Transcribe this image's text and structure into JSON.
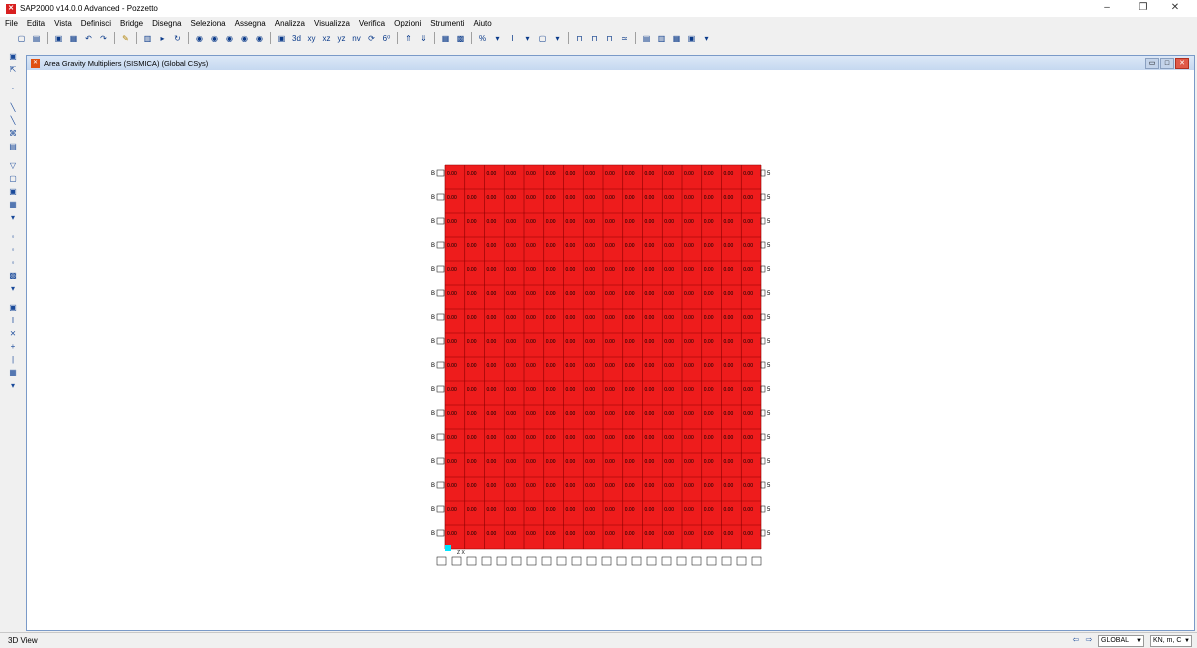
{
  "window": {
    "title": "SAP2000 v14.0.0 Advanced  - Pozzetto",
    "minimize": "–",
    "maximize": "❐",
    "close": "✕"
  },
  "menu": [
    "File",
    "Edita",
    "Vista",
    "Definisci",
    "Bridge",
    "Disegna",
    "Seleziona",
    "Assegna",
    "Analizza",
    "Visualizza",
    "Verifica",
    "Opzioni",
    "Strumenti",
    "Aiuto"
  ],
  "toolbar": {
    "icons": [
      "new-model-icon",
      "open-icon",
      "save-icon",
      "unknown-icon",
      "undo-icon",
      "redo-icon",
      "refresh-window-icon",
      "lock-icon",
      "run-analysis-icon",
      "rubber-band-zoom-icon",
      "restore-view-icon",
      "zoom-in-icon",
      "zoom-out-icon",
      "pan-icon",
      "set-3d-view-icon",
      "xy-view-icon",
      "xz-view-icon",
      "yz-view-icon",
      "nv-view-icon",
      "rotate-3d-icon",
      "perspective-icon",
      "up-icon",
      "down-icon",
      "object-shrink-icon",
      "set-display-icon",
      "show-undeformed-icon",
      "show-deformed-icon",
      "show-forces-icon",
      "show-stress-icon",
      "table-icon",
      "more-icon"
    ],
    "text_buttons": [
      "3d",
      "xy",
      "xz",
      "yz",
      "nv",
      "6⁰"
    ]
  },
  "left_toolbar": {
    "icons": [
      "pointer-icon",
      "reshape-icon",
      "draw-point-icon",
      "draw-frame-icon",
      "draw-cable-icon",
      "draw-link-icon",
      "quick-frame-icon",
      "draw-poly-area-icon",
      "draw-rect-area-icon",
      "quick-area-icon",
      "draw-solid-icon",
      "select-all-icon",
      "get-previous-icon",
      "clear-selection-icon",
      "intersect-line-icon",
      "snap-points-icon",
      "snap-ends-icon",
      "snap-intersections-icon",
      "snap-perpendicular-icon",
      "snap-lines-icon"
    ]
  },
  "inner_window": {
    "title": "Area Gravity Multipliers (SISMICA) (Global CSys)",
    "restore": "▭",
    "maximize": "□",
    "close": "✕"
  },
  "mesh": {
    "rows": 16,
    "cols": 16,
    "fill_color": "#ee1c1c",
    "grid_color": "#000000",
    "row_label_left": "B",
    "row_label_right": "5",
    "cell_label": "0.00",
    "base_label": "Z X"
  },
  "status": {
    "view_label": "3D View",
    "coord_system": "GLOBAL",
    "units": "KN, m, C"
  }
}
